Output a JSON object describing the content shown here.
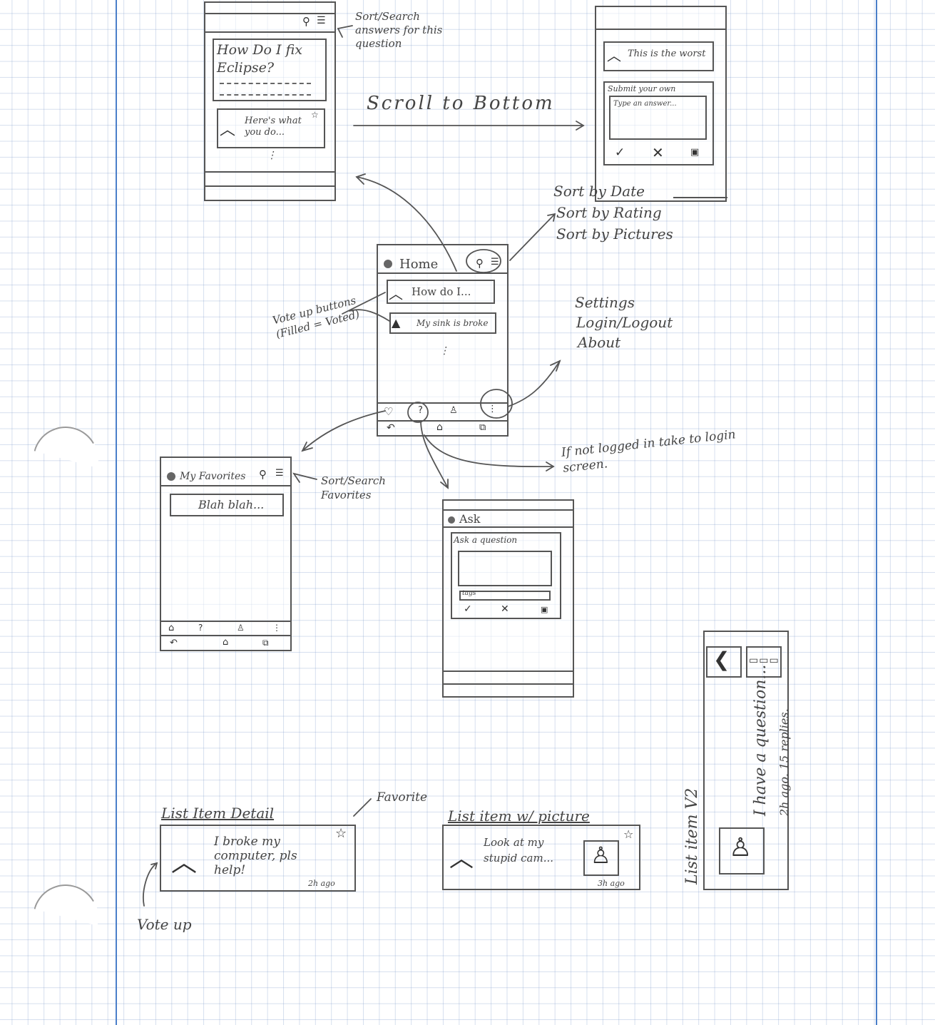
{
  "screens": {
    "question": {
      "question_title": "How Do I fix Eclipse?",
      "answer_text": "Here's what you do...",
      "more": "⋮"
    },
    "question_bottom": {
      "answer_text": "This is the worst",
      "submit_label": "Submit your own",
      "answer_placeholder": "Type an answer..."
    },
    "home": {
      "title": "Home",
      "items": [
        "How do I...",
        "My sink is broke"
      ],
      "more": "⋮"
    },
    "favorites": {
      "title": "My Favorites",
      "item": "Blah blah..."
    },
    "ask": {
      "title": "Ask",
      "question_label": "Ask a question",
      "tags_label": "tags"
    }
  },
  "annotations": {
    "sort_search_answers": "Sort/Search answers for this question",
    "scroll_to_bottom": "Scroll to Bottom",
    "sort_options": [
      "Sort by Date",
      "Sort by Rating",
      "Sort by Pictures"
    ],
    "menu_options": [
      "Settings",
      "Login/Logout",
      "About"
    ],
    "vote_up_buttons": "Vote up buttons (Filled = Voted)",
    "sort_search_favorites": "Sort/Search Favorites",
    "login_redirect": "If not logged in take to login screen.",
    "favorite": "Favorite",
    "vote_up": "Vote up"
  },
  "list_items": {
    "detail": {
      "heading": "List Item Detail",
      "text": "I broke my computer, pls help!",
      "time": "2h ago"
    },
    "picture": {
      "heading": "List item w/ picture",
      "text": "Look at my stupid cam...",
      "time": "3h ago"
    },
    "v2": {
      "heading": "List item V2",
      "text": "I have a question...",
      "meta": "2h ago. 15 replies."
    }
  },
  "colors": {
    "ink": "#444444",
    "margin": "#4a7fc9",
    "grid": "#aabbdd"
  }
}
